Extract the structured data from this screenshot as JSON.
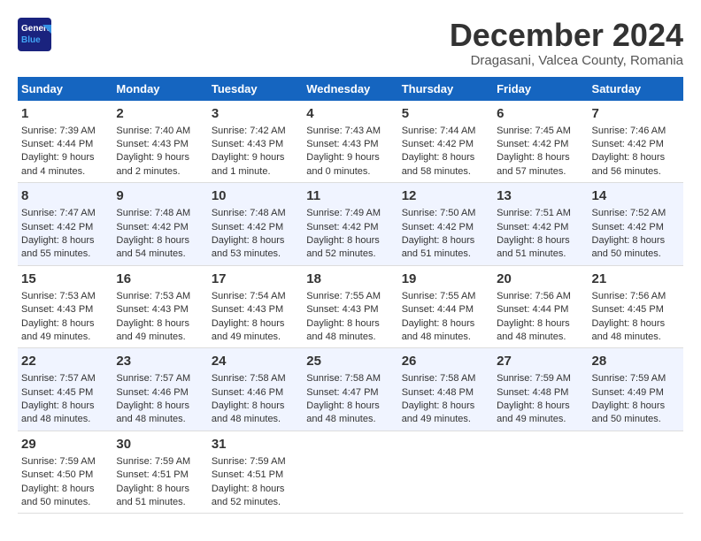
{
  "header": {
    "logo_line1": "General",
    "logo_line2": "Blue",
    "month": "December 2024",
    "location": "Dragasani, Valcea County, Romania"
  },
  "days_of_week": [
    "Sunday",
    "Monday",
    "Tuesday",
    "Wednesday",
    "Thursday",
    "Friday",
    "Saturday"
  ],
  "weeks": [
    [
      {
        "day": "1",
        "sunrise": "Sunrise: 7:39 AM",
        "sunset": "Sunset: 4:44 PM",
        "daylight": "Daylight: 9 hours and 4 minutes."
      },
      {
        "day": "2",
        "sunrise": "Sunrise: 7:40 AM",
        "sunset": "Sunset: 4:43 PM",
        "daylight": "Daylight: 9 hours and 2 minutes."
      },
      {
        "day": "3",
        "sunrise": "Sunrise: 7:42 AM",
        "sunset": "Sunset: 4:43 PM",
        "daylight": "Daylight: 9 hours and 1 minute."
      },
      {
        "day": "4",
        "sunrise": "Sunrise: 7:43 AM",
        "sunset": "Sunset: 4:43 PM",
        "daylight": "Daylight: 9 hours and 0 minutes."
      },
      {
        "day": "5",
        "sunrise": "Sunrise: 7:44 AM",
        "sunset": "Sunset: 4:42 PM",
        "daylight": "Daylight: 8 hours and 58 minutes."
      },
      {
        "day": "6",
        "sunrise": "Sunrise: 7:45 AM",
        "sunset": "Sunset: 4:42 PM",
        "daylight": "Daylight: 8 hours and 57 minutes."
      },
      {
        "day": "7",
        "sunrise": "Sunrise: 7:46 AM",
        "sunset": "Sunset: 4:42 PM",
        "daylight": "Daylight: 8 hours and 56 minutes."
      }
    ],
    [
      {
        "day": "8",
        "sunrise": "Sunrise: 7:47 AM",
        "sunset": "Sunset: 4:42 PM",
        "daylight": "Daylight: 8 hours and 55 minutes."
      },
      {
        "day": "9",
        "sunrise": "Sunrise: 7:48 AM",
        "sunset": "Sunset: 4:42 PM",
        "daylight": "Daylight: 8 hours and 54 minutes."
      },
      {
        "day": "10",
        "sunrise": "Sunrise: 7:48 AM",
        "sunset": "Sunset: 4:42 PM",
        "daylight": "Daylight: 8 hours and 53 minutes."
      },
      {
        "day": "11",
        "sunrise": "Sunrise: 7:49 AM",
        "sunset": "Sunset: 4:42 PM",
        "daylight": "Daylight: 8 hours and 52 minutes."
      },
      {
        "day": "12",
        "sunrise": "Sunrise: 7:50 AM",
        "sunset": "Sunset: 4:42 PM",
        "daylight": "Daylight: 8 hours and 51 minutes."
      },
      {
        "day": "13",
        "sunrise": "Sunrise: 7:51 AM",
        "sunset": "Sunset: 4:42 PM",
        "daylight": "Daylight: 8 hours and 51 minutes."
      },
      {
        "day": "14",
        "sunrise": "Sunrise: 7:52 AM",
        "sunset": "Sunset: 4:42 PM",
        "daylight": "Daylight: 8 hours and 50 minutes."
      }
    ],
    [
      {
        "day": "15",
        "sunrise": "Sunrise: 7:53 AM",
        "sunset": "Sunset: 4:43 PM",
        "daylight": "Daylight: 8 hours and 49 minutes."
      },
      {
        "day": "16",
        "sunrise": "Sunrise: 7:53 AM",
        "sunset": "Sunset: 4:43 PM",
        "daylight": "Daylight: 8 hours and 49 minutes."
      },
      {
        "day": "17",
        "sunrise": "Sunrise: 7:54 AM",
        "sunset": "Sunset: 4:43 PM",
        "daylight": "Daylight: 8 hours and 49 minutes."
      },
      {
        "day": "18",
        "sunrise": "Sunrise: 7:55 AM",
        "sunset": "Sunset: 4:43 PM",
        "daylight": "Daylight: 8 hours and 48 minutes."
      },
      {
        "day": "19",
        "sunrise": "Sunrise: 7:55 AM",
        "sunset": "Sunset: 4:44 PM",
        "daylight": "Daylight: 8 hours and 48 minutes."
      },
      {
        "day": "20",
        "sunrise": "Sunrise: 7:56 AM",
        "sunset": "Sunset: 4:44 PM",
        "daylight": "Daylight: 8 hours and 48 minutes."
      },
      {
        "day": "21",
        "sunrise": "Sunrise: 7:56 AM",
        "sunset": "Sunset: 4:45 PM",
        "daylight": "Daylight: 8 hours and 48 minutes."
      }
    ],
    [
      {
        "day": "22",
        "sunrise": "Sunrise: 7:57 AM",
        "sunset": "Sunset: 4:45 PM",
        "daylight": "Daylight: 8 hours and 48 minutes."
      },
      {
        "day": "23",
        "sunrise": "Sunrise: 7:57 AM",
        "sunset": "Sunset: 4:46 PM",
        "daylight": "Daylight: 8 hours and 48 minutes."
      },
      {
        "day": "24",
        "sunrise": "Sunrise: 7:58 AM",
        "sunset": "Sunset: 4:46 PM",
        "daylight": "Daylight: 8 hours and 48 minutes."
      },
      {
        "day": "25",
        "sunrise": "Sunrise: 7:58 AM",
        "sunset": "Sunset: 4:47 PM",
        "daylight": "Daylight: 8 hours and 48 minutes."
      },
      {
        "day": "26",
        "sunrise": "Sunrise: 7:58 AM",
        "sunset": "Sunset: 4:48 PM",
        "daylight": "Daylight: 8 hours and 49 minutes."
      },
      {
        "day": "27",
        "sunrise": "Sunrise: 7:59 AM",
        "sunset": "Sunset: 4:48 PM",
        "daylight": "Daylight: 8 hours and 49 minutes."
      },
      {
        "day": "28",
        "sunrise": "Sunrise: 7:59 AM",
        "sunset": "Sunset: 4:49 PM",
        "daylight": "Daylight: 8 hours and 50 minutes."
      }
    ],
    [
      {
        "day": "29",
        "sunrise": "Sunrise: 7:59 AM",
        "sunset": "Sunset: 4:50 PM",
        "daylight": "Daylight: 8 hours and 50 minutes."
      },
      {
        "day": "30",
        "sunrise": "Sunrise: 7:59 AM",
        "sunset": "Sunset: 4:51 PM",
        "daylight": "Daylight: 8 hours and 51 minutes."
      },
      {
        "day": "31",
        "sunrise": "Sunrise: 7:59 AM",
        "sunset": "Sunset: 4:51 PM",
        "daylight": "Daylight: 8 hours and 52 minutes."
      },
      null,
      null,
      null,
      null
    ]
  ]
}
